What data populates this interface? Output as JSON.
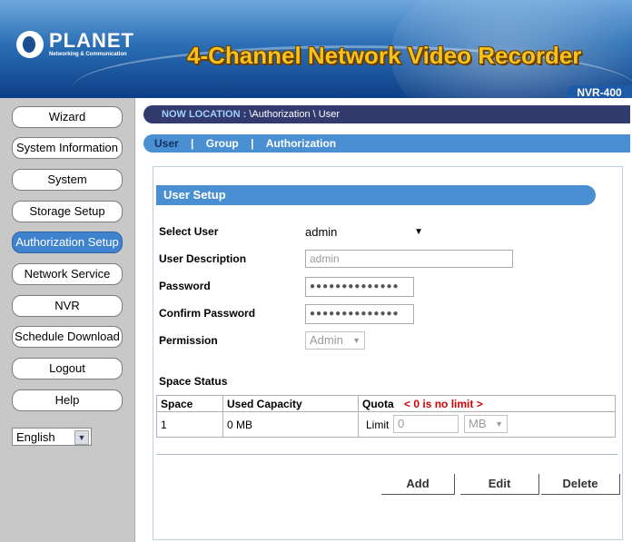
{
  "header": {
    "logo": {
      "brand": "PLANET",
      "tagline": "Networking & Communication"
    },
    "product_title": "4-Channel Network Video Recorder",
    "model": "NVR-400"
  },
  "sidebar": {
    "items": [
      {
        "label": "Wizard",
        "active": false
      },
      {
        "label": "System Information",
        "active": false
      },
      {
        "label": "System",
        "active": false
      },
      {
        "label": "Storage Setup",
        "active": false
      },
      {
        "label": "Authorization Setup",
        "active": true
      },
      {
        "label": "Network Service",
        "active": false
      },
      {
        "label": "NVR",
        "active": false
      },
      {
        "label": "Schedule Download",
        "active": false
      },
      {
        "label": "Logout",
        "active": false
      },
      {
        "label": "Help",
        "active": false
      }
    ],
    "language": "English"
  },
  "location": {
    "label": "NOW LOCATION :",
    "path": "\\Authorization \\ User"
  },
  "tabs": [
    {
      "label": "User",
      "active": true
    },
    {
      "label": "Group",
      "active": false
    },
    {
      "label": "Authorization",
      "active": false
    }
  ],
  "tab_separator": "|",
  "user_setup": {
    "title": "User Setup",
    "select_user_label": "Select User",
    "select_user_value": "admin",
    "description_label": "User Description",
    "description_value": "admin",
    "password_label": "Password",
    "password_value": "●●●●●●●●●●●●●●",
    "confirm_label": "Confirm Password",
    "confirm_value": "●●●●●●●●●●●●●●",
    "permission_label": "Permission",
    "permission_value": "Admin"
  },
  "space_status": {
    "title": "Space Status",
    "headers": {
      "space": "Space",
      "used": "Used Capacity",
      "quota": "Quota"
    },
    "quota_note": "< 0 is no limit >",
    "row": {
      "space": "1",
      "used": "0 MB",
      "limit_label": "Limit",
      "limit_value": "0",
      "unit": "MB"
    }
  },
  "actions": {
    "add": "Add",
    "edit": "Edit",
    "delete": "Delete"
  },
  "colors": {
    "accent": "#4a8fd2",
    "location_bar": "#333a6e",
    "note": "#d40000"
  }
}
